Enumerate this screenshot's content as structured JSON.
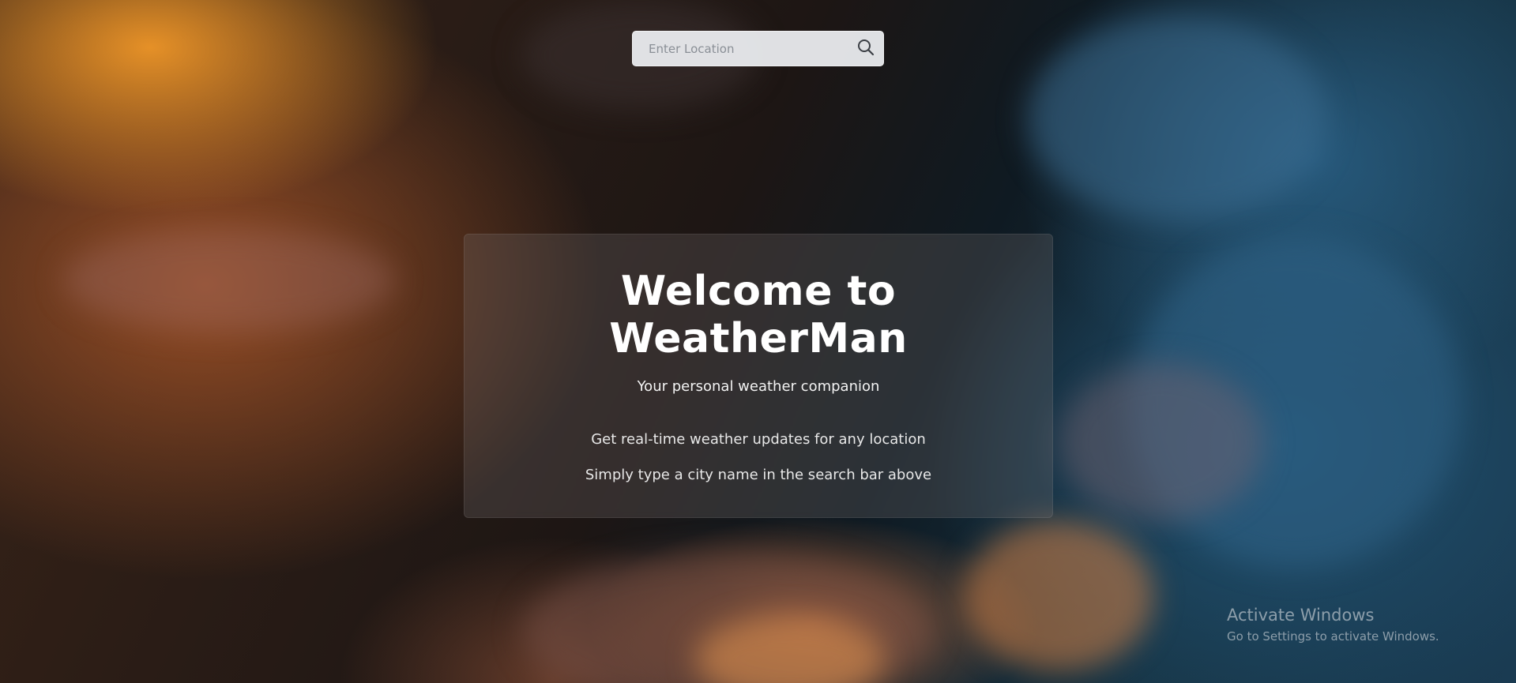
{
  "search": {
    "placeholder": "Enter Location",
    "value": "",
    "icon": "search-icon"
  },
  "welcome": {
    "title_line1": "Welcome to",
    "title_line2": "WeatherMan",
    "subtitle": "Your personal weather companion",
    "line1": "Get real-time weather updates for any location",
    "line2": "Simply type a city name in the search bar above"
  },
  "watermark": {
    "title": "Activate Windows",
    "subtitle": "Go to Settings to activate Windows."
  },
  "colors": {
    "search_bg": "#eef0f3",
    "text_primary": "#ffffff",
    "card_overlay": "rgba(120,110,110,0.28)"
  }
}
